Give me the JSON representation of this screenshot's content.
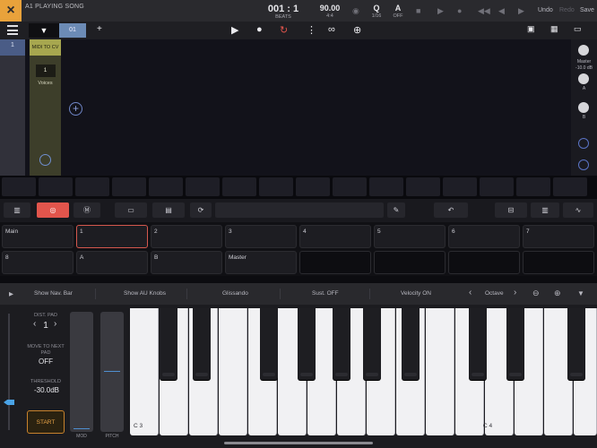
{
  "top": {
    "close_glyph": "×",
    "song": "A1 PLAYING SONG",
    "position": "001 : 1",
    "position_unit": "BEATS",
    "tempo": "90.00",
    "meter": "4:4",
    "quantize_big": "Q",
    "quantize_small": "1/16",
    "arp_big": "A",
    "arp_small": "OFF",
    "undo": "Undo",
    "redo": "Redo",
    "save": "Save"
  },
  "bar2": {
    "selector_glyph": "▼",
    "sequence_tab": "01",
    "add_glyph": "+"
  },
  "tracks": {
    "number": "1",
    "plugin_name": "MIDI TO CV",
    "voices_value": "1",
    "voices_label": "Voices",
    "add_glyph": "+"
  },
  "mixer": {
    "master_label": "Master",
    "master_value": "-10.0 dB",
    "a_label": "A",
    "b_label": "B"
  },
  "pads": [
    {
      "label": "Main",
      "empty": false
    },
    {
      "label": "1",
      "empty": false,
      "selected": true
    },
    {
      "label": "2",
      "empty": false
    },
    {
      "label": "3",
      "empty": false
    },
    {
      "label": "4",
      "empty": false
    },
    {
      "label": "5",
      "empty": false
    },
    {
      "label": "6",
      "empty": false
    },
    {
      "label": "7",
      "empty": false
    },
    {
      "label": "8",
      "empty": false
    },
    {
      "label": "A",
      "empty": false
    },
    {
      "label": "B",
      "empty": false
    },
    {
      "label": "Master",
      "empty": false
    },
    {
      "label": "",
      "empty": true
    },
    {
      "label": "",
      "empty": true
    },
    {
      "label": "",
      "empty": true
    },
    {
      "label": "",
      "empty": true
    }
  ],
  "options": {
    "nav": "Show Nav. Bar",
    "au_knobs": "Show AU Knobs",
    "glissando": "Glissando",
    "sustain": "Sust. OFF",
    "velocity": "Velocity ON",
    "octave": "Octave"
  },
  "left_panel": {
    "dist_label": "DIST. PAD",
    "dist_value": "1",
    "move_label": "MOVE TO NEXT PAD",
    "move_value": "OFF",
    "threshold_label": "THRESHOLD",
    "threshold_value": "-30.0dB",
    "start": "START",
    "mod_label": "MOD",
    "pitch_label": "PITCH"
  },
  "keyboard": {
    "c3": "C 3",
    "c4": "C 4"
  },
  "colors": {
    "accent_orange": "#e9a23b",
    "record_red": "#e2554c",
    "plugin_yellow": "#a7a74f",
    "track_blue": "#4a5c86"
  }
}
